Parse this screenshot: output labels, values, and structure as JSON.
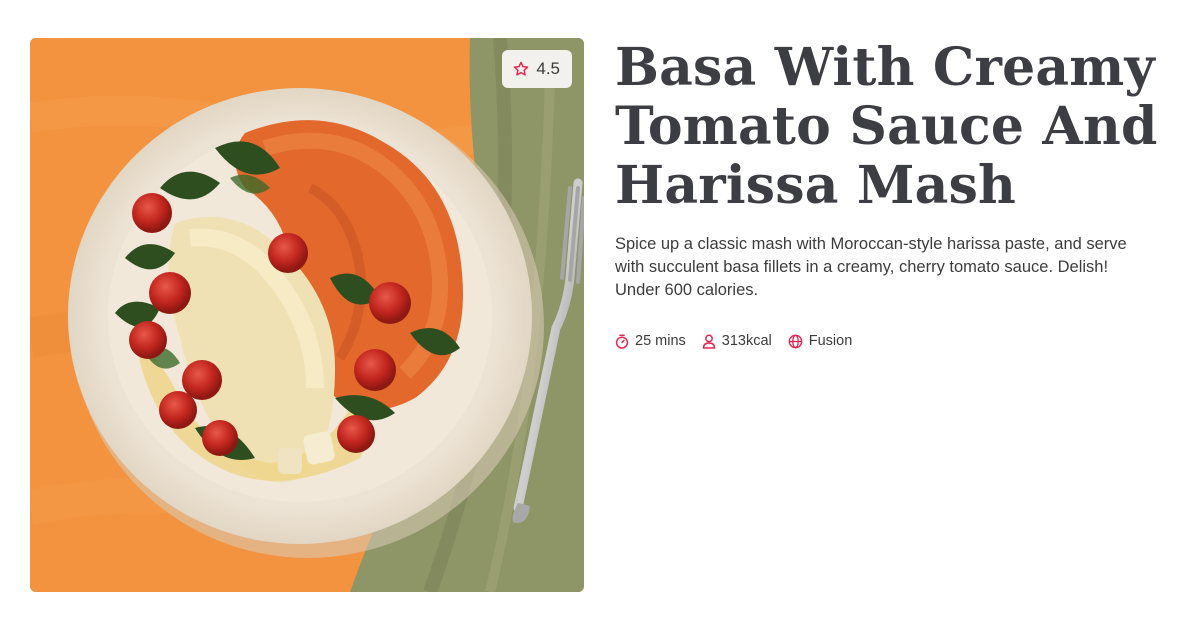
{
  "recipe": {
    "title": "Basa With Creamy Tomato Sauce And Harissa Mash",
    "description": "Spice up a classic mash with Moroccan-style harissa paste, and serve with succulent basa fillets in a creamy, cherry tomato sauce. Delish! Under 600 calories.",
    "rating": "4.5",
    "meta": {
      "time": "25 mins",
      "calories": "313kcal",
      "cuisine": "Fusion"
    }
  },
  "icons": {
    "rating": "star-icon",
    "time": "timer-icon",
    "calories": "person-icon",
    "cuisine": "globe-icon"
  },
  "colors": {
    "accent": "#e8254e",
    "title": "#3d3d44",
    "text": "#3c3c3c",
    "badge_bg": "#f3f1ee"
  }
}
